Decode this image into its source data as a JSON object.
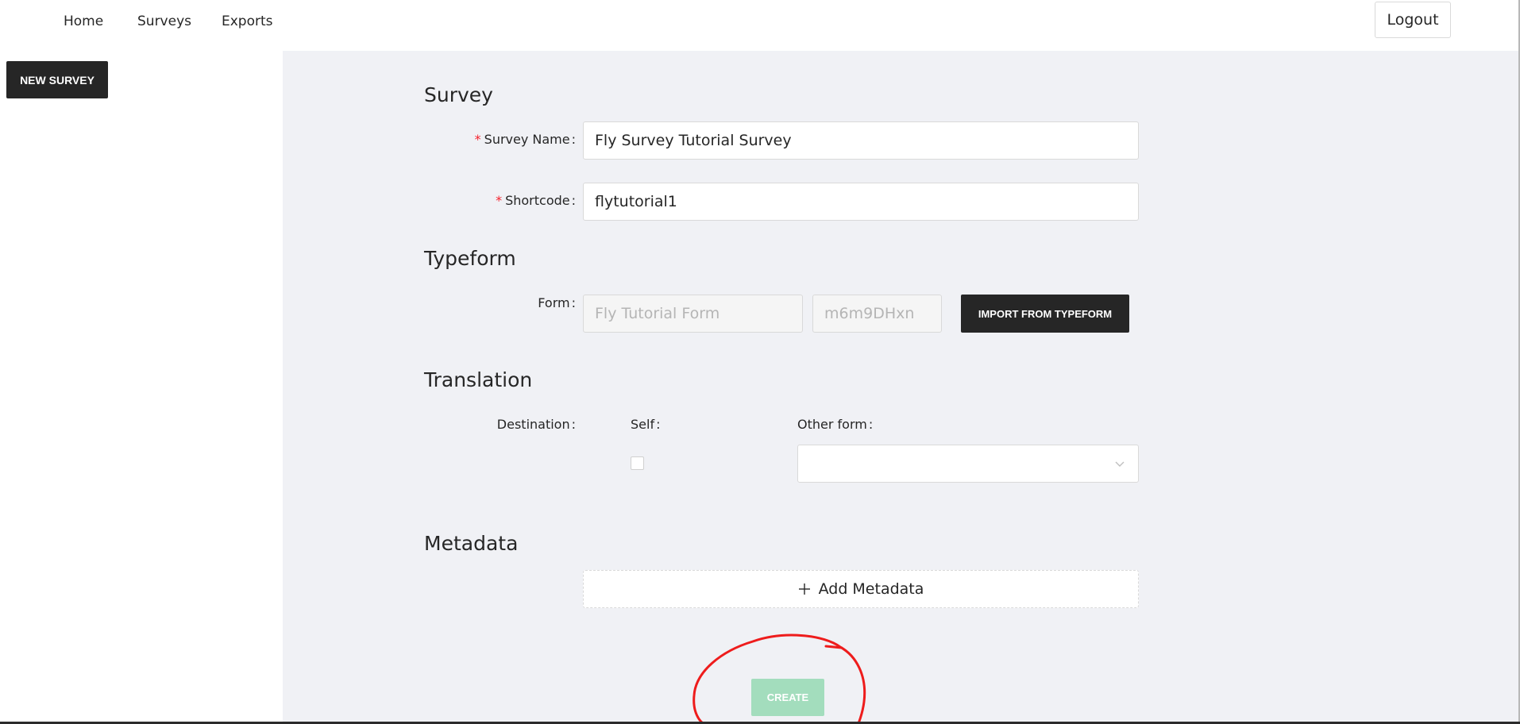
{
  "nav": {
    "items": [
      {
        "label": "Home"
      },
      {
        "label": "Surveys"
      },
      {
        "label": "Exports"
      }
    ],
    "logout_label": "Logout"
  },
  "sidebar": {
    "new_survey_label": "NEW SURVEY"
  },
  "form": {
    "survey": {
      "title": "Survey",
      "name_label": "Survey Name",
      "name_value": "Fly Survey Tutorial Survey",
      "shortcode_label": "Shortcode",
      "shortcode_value": "flytutorial1",
      "required_mark": "*",
      "colon": ":"
    },
    "typeform": {
      "title": "Typeform",
      "form_label": "Form",
      "form_name_value": "Fly Tutorial Form",
      "form_id_value": "m6m9DHxn",
      "import_label": "IMPORT FROM TYPEFORM"
    },
    "translation": {
      "title": "Translation",
      "destination_label": "Destination",
      "self_label": "Self",
      "self_checked": false,
      "other_form_label": "Other form",
      "other_form_value": ""
    },
    "metadata": {
      "title": "Metadata",
      "add_label": "Add Metadata"
    },
    "create_label": "CREATE"
  },
  "annotation": {
    "color": "#ee1c1c",
    "shape": "hand-drawn circle around create button"
  },
  "colors": {
    "content_bg": "#f0f1f5",
    "dark_button": "#262626",
    "create_button_disabled": "#a3ddbd",
    "required": "#f5222d"
  }
}
